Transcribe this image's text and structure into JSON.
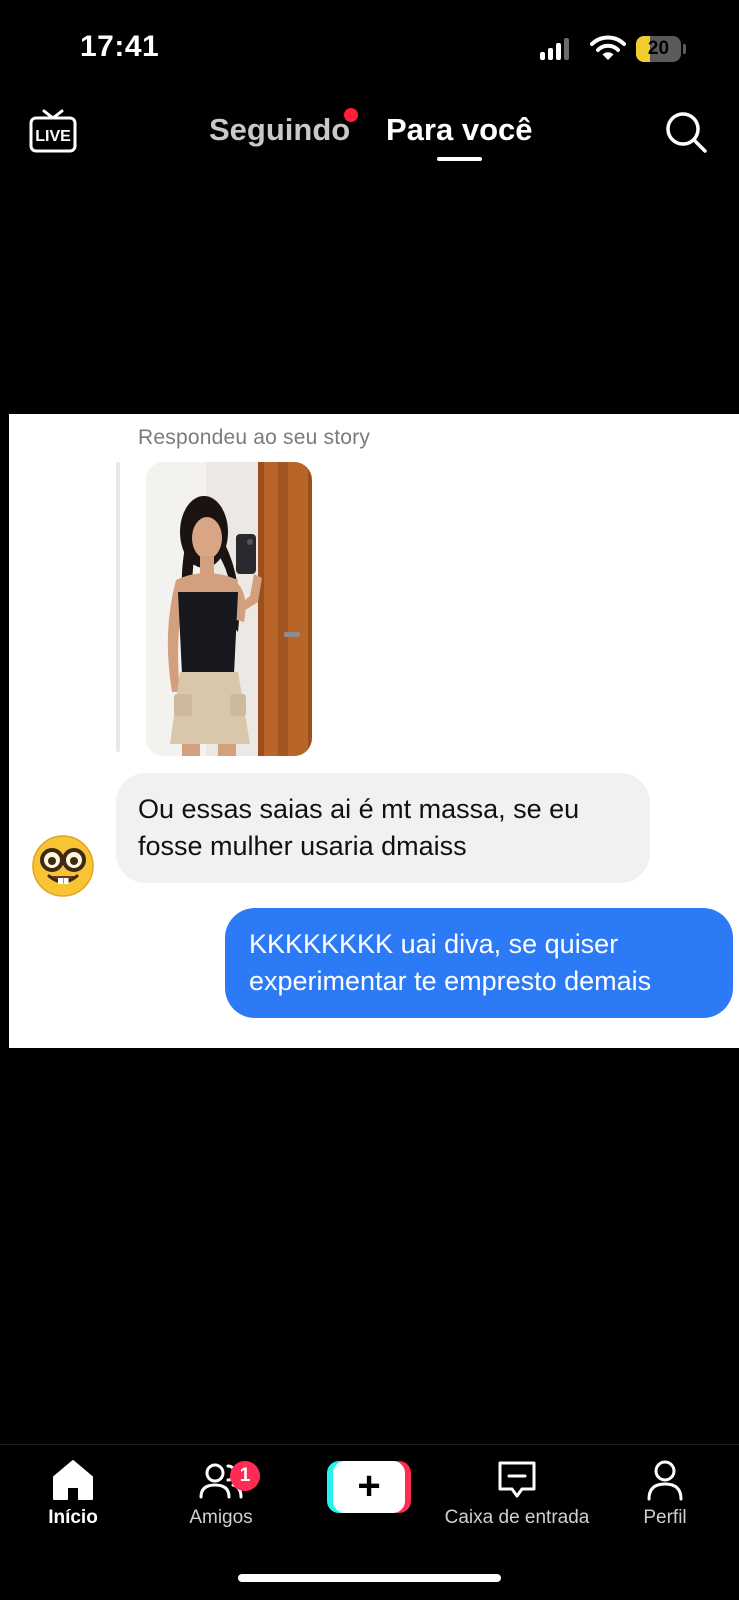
{
  "status_bar": {
    "time": "17:41",
    "battery_level": "20",
    "battery_fraction": 0.2,
    "battery_color": "#f2cd2e",
    "icons": [
      "signal-icon",
      "wifi-icon",
      "battery-icon"
    ]
  },
  "top_nav": {
    "live_icon": "live-icon",
    "tabs": [
      {
        "label": "Seguindo",
        "active": false,
        "has_dot": true
      },
      {
        "label": "Para você",
        "active": true
      }
    ],
    "search_icon": "search-icon",
    "dot_color": "#ff1e3c"
  },
  "post": {
    "reply_label": "Respondeu ao seu story",
    "story_image": "story-photo",
    "avatar_emoji": "🤓",
    "messages": [
      {
        "direction": "incoming",
        "text": "Ou essas saias ai é mt massa, se eu fosse mulher usaria dmaiss"
      },
      {
        "direction": "outgoing",
        "text": "KKKKKKKK uai diva, se quiser experimentar te empresto demais"
      }
    ],
    "outgoing_color": "#2c7af6",
    "incoming_color": "#f1f1f2"
  },
  "bottom_nav": {
    "items": [
      {
        "label": "Início",
        "icon": "home-icon",
        "active": true
      },
      {
        "label": "Amigos",
        "icon": "friends-icon",
        "badge": "1"
      },
      {
        "label": "",
        "icon": "create-icon",
        "symbol": "+"
      },
      {
        "label": "Caixa de entrada",
        "icon": "inbox-icon"
      },
      {
        "label": "Perfil",
        "icon": "profile-icon"
      }
    ],
    "badge_color": "#fe2c55"
  }
}
